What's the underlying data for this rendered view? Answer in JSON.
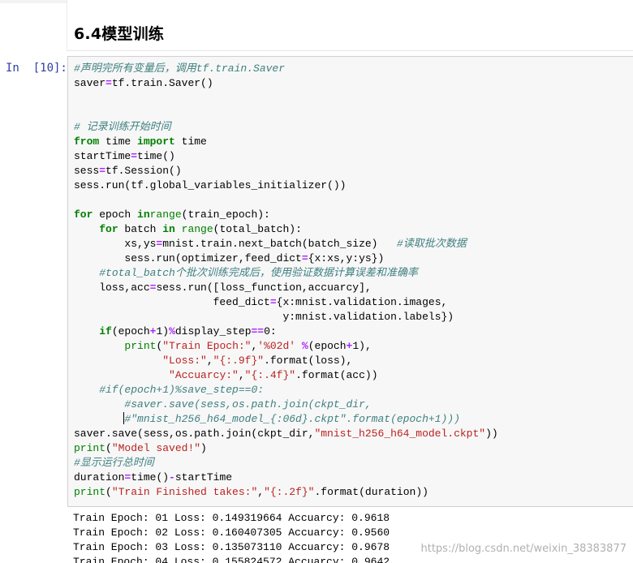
{
  "markdown": {
    "heading": "6.4模型训练"
  },
  "cell": {
    "prompt": "In  [10]:",
    "code": [
      [
        [
          "cm",
          "#声明完所有变量后，调用tf.train.Saver"
        ]
      ],
      [
        [
          "",
          "saver"
        ],
        [
          "op",
          "="
        ],
        [
          "",
          "tf.train.Saver()"
        ]
      ],
      [
        [
          "",
          ""
        ]
      ],
      [
        [
          "",
          ""
        ]
      ],
      [
        [
          "cm",
          "# 记录训练开始时间"
        ]
      ],
      [
        [
          "kw",
          "from"
        ],
        [
          "",
          " time "
        ],
        [
          "kw",
          "import"
        ],
        [
          "",
          " time"
        ]
      ],
      [
        [
          "",
          "startTime"
        ],
        [
          "op",
          "="
        ],
        [
          "",
          "time()"
        ]
      ],
      [
        [
          "",
          "sess"
        ],
        [
          "op",
          "="
        ],
        [
          "",
          "tf.Session()"
        ]
      ],
      [
        [
          "",
          "sess.run(tf.global_variables_initializer())"
        ]
      ],
      [
        [
          "",
          ""
        ]
      ],
      [
        [
          "kw",
          "for"
        ],
        [
          "",
          " epoch "
        ],
        [
          "kw",
          "in"
        ],
        [
          "",
          "",
          " "
        ],
        [
          "bi",
          "range"
        ],
        [
          "",
          "(train_epoch):"
        ]
      ],
      [
        [
          "",
          "    "
        ],
        [
          "kw",
          "for"
        ],
        [
          "",
          " batch "
        ],
        [
          "kw",
          "in"
        ],
        [
          "",
          " "
        ],
        [
          "bi",
          "range"
        ],
        [
          "",
          "(total_batch):"
        ]
      ],
      [
        [
          "",
          "        xs,ys"
        ],
        [
          "op",
          "="
        ],
        [
          "",
          "mnist.train.next_batch(batch_size)   "
        ],
        [
          "cm",
          "#读取批次数据"
        ]
      ],
      [
        [
          "",
          "        sess.run(optimizer,feed_dict"
        ],
        [
          "op",
          "="
        ],
        [
          "",
          "{x:xs,y:ys})"
        ]
      ],
      [
        [
          "",
          "    "
        ],
        [
          "cm",
          "#total_batch个批次训练完成后，使用验证数据计算误差和准确率"
        ]
      ],
      [
        [
          "",
          "    loss,acc"
        ],
        [
          "op",
          "="
        ],
        [
          "",
          "sess.run([loss_function,accuarcy],"
        ]
      ],
      [
        [
          "",
          "                      feed_dict"
        ],
        [
          "op",
          "="
        ],
        [
          "",
          "{x:mnist.validation.images,"
        ]
      ],
      [
        [
          "",
          "                                 y:mnist.validation.labels})"
        ]
      ],
      [
        [
          "",
          "    "
        ],
        [
          "kw",
          "if"
        ],
        [
          "",
          "(epoch"
        ],
        [
          "op",
          "+"
        ],
        [
          "",
          "1)"
        ],
        [
          "op",
          "%"
        ],
        [
          "",
          "display_step"
        ],
        [
          "op",
          "=="
        ],
        [
          "",
          "0:"
        ]
      ],
      [
        [
          "",
          "        "
        ],
        [
          "bi",
          "print"
        ],
        [
          "",
          "("
        ],
        [
          "str",
          "\"Train Epoch:\""
        ],
        [
          "",
          ","
        ],
        [
          "str",
          "'%02d'"
        ],
        [
          "",
          " "
        ],
        [
          "op",
          "%"
        ],
        [
          "",
          "(epoch"
        ],
        [
          "op",
          "+"
        ],
        [
          "",
          "1),"
        ]
      ],
      [
        [
          "",
          "              "
        ],
        [
          "str",
          "\"Loss:\""
        ],
        [
          "",
          ","
        ],
        [
          "str",
          "\"{:.9f}\""
        ],
        [
          "",
          ".format(loss),"
        ]
      ],
      [
        [
          "",
          "               "
        ],
        [
          "str",
          "\"Accuarcy:\""
        ],
        [
          "",
          ","
        ],
        [
          "str",
          "\"{:.4f}\""
        ],
        [
          "",
          ".format(acc))"
        ]
      ],
      [
        [
          "",
          "    "
        ],
        [
          "cm",
          "#if(epoch+1)%save_step==0:"
        ]
      ],
      [
        [
          "",
          "        "
        ],
        [
          "cm",
          "#saver.save(sess,os.path.join(ckpt_dir,"
        ]
      ],
      [
        [
          "",
          "        "
        ],
        [
          "cursor",
          ""
        ],
        [
          "cm",
          "#\"mnist_h256_h64_model_{:06d}.ckpt\".format(epoch+1)))"
        ]
      ],
      [
        [
          "",
          "saver.save(sess,os.path.join(ckpt_dir,"
        ],
        [
          "str",
          "\"mnist_h256_h64_model.ckpt\""
        ],
        [
          "",
          "))"
        ]
      ],
      [
        [
          "bi",
          "print"
        ],
        [
          "",
          "("
        ],
        [
          "str",
          "\"Model saved!\""
        ],
        [
          "",
          ")"
        ]
      ],
      [
        [
          "cm",
          "#显示运行总时间"
        ]
      ],
      [
        [
          "",
          "duration"
        ],
        [
          "op",
          "="
        ],
        [
          "",
          "time()"
        ],
        [
          "op",
          "-"
        ],
        [
          "",
          "startTime"
        ]
      ],
      [
        [
          "bi",
          "print"
        ],
        [
          "",
          "("
        ],
        [
          "str",
          "\"Train Finished takes:\""
        ],
        [
          "",
          ","
        ],
        [
          "str",
          "\"{:.2f}\""
        ],
        [
          "",
          ".format(duration))"
        ]
      ]
    ],
    "output": [
      "Train Epoch: 01 Loss: 0.149319664 Accuarcy: 0.9618",
      "Train Epoch: 02 Loss: 0.160407305 Accuarcy: 0.9560",
      "Train Epoch: 03 Loss: 0.135073110 Accuarcy: 0.9678",
      "Train Epoch: 04 Loss: 0.155824572 Accuarcy: 0.9642"
    ]
  },
  "watermark": "https://blog.csdn.net/weixin_38383877"
}
